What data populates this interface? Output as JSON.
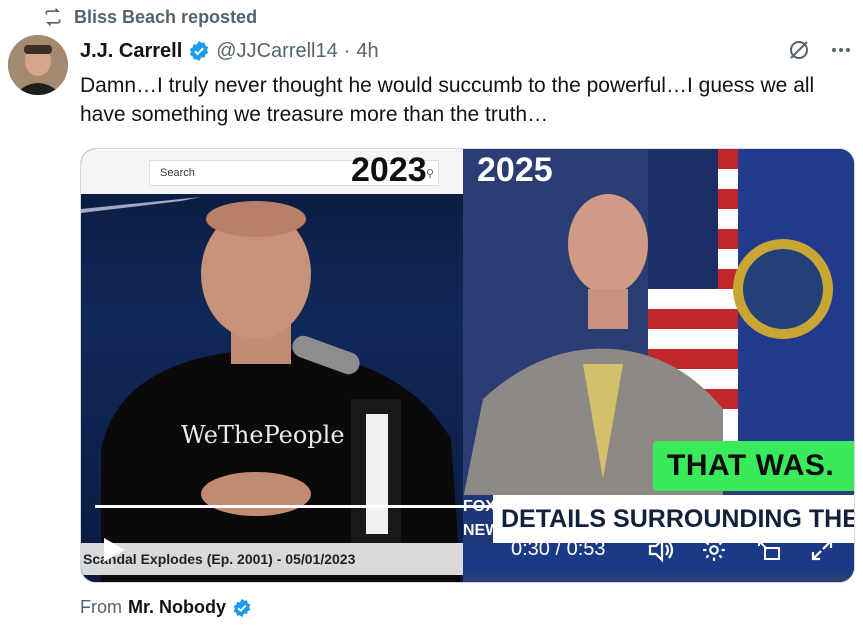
{
  "repost": {
    "text": "Bliss Beach reposted"
  },
  "tweet": {
    "display_name": "J.J. Carrell",
    "handle": "@JJCarrell14",
    "separator": "·",
    "time": "4h",
    "text": "Damn…I truly never thought he would succumb to the powerful…I guess we all have something we treasure more than the truth…"
  },
  "video": {
    "left_panel": {
      "year": "2023",
      "search_label": "Search",
      "shirt_text": "WeThePeople",
      "episode_text": "Scandal Explodes (Ep. 2001) - 05/01/2023"
    },
    "right_panel": {
      "year": "2025",
      "green_banner": "THAT WAS.",
      "headline": "DETAILS SURROUNDING THE DEA",
      "network_logo": "FOX NEWS"
    },
    "current_time": "0:30",
    "duration": "0:53",
    "time_separator": " / ",
    "progress_fraction": 0.566
  },
  "source": {
    "label": "From",
    "name": "Mr. Nobody"
  },
  "colors": {
    "verified": "#1d9bf0",
    "muted_text": "#536471",
    "green_banner": "#39ea5a"
  },
  "icons": [
    "repost-icon",
    "verified-icon",
    "grok-icon",
    "more-icon",
    "play-icon",
    "volume-icon",
    "settings-icon",
    "pip-icon",
    "fullscreen-icon"
  ]
}
